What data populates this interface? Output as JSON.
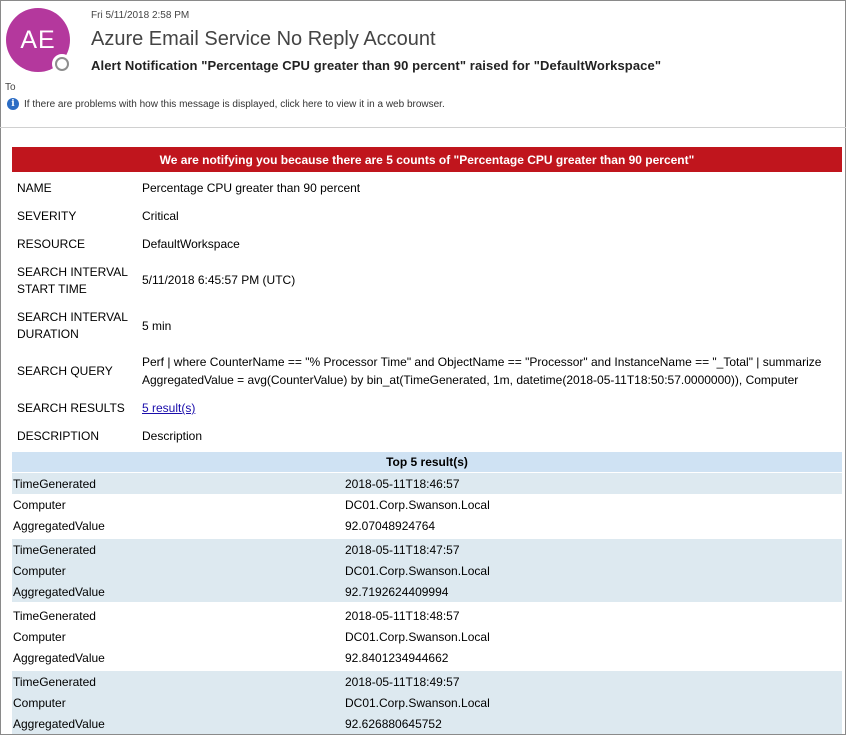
{
  "message": {
    "avatar_initials": "AE",
    "date": "Fri 5/11/2018 2:58 PM",
    "sender": "Azure Email Service No Reply Account",
    "subject": "Alert Notification \"Percentage CPU greater than 90 percent\" raised for \"DefaultWorkspace\"",
    "to_label": "To",
    "info_text": "If there are problems with how this message is displayed, click here to view it in a web browser."
  },
  "banner": "We are notifying you because there are 5 counts of \"Percentage CPU greater than 90 percent\"",
  "fields": {
    "name_label": "NAME",
    "name_value": "Percentage CPU greater than 90 percent",
    "severity_label": "SEVERITY",
    "severity_value": "Critical",
    "resource_label": "RESOURCE",
    "resource_value": "DefaultWorkspace",
    "start_label_1": "SEARCH INTERVAL",
    "start_label_2": "START TIME",
    "start_value": "5/11/2018 6:45:57 PM (UTC)",
    "duration_label_1": "SEARCH INTERVAL",
    "duration_label_2": "DURATION",
    "duration_value": "5 min",
    "query_label": "SEARCH QUERY",
    "query_line_1": "Perf | where CounterName == \"% Processor Time\" and ObjectName == \"Processor\" and InstanceName == \"_Total\" | summarize",
    "query_line_2": "AggregatedValue = avg(CounterValue) by bin_at(TimeGenerated, 1m, datetime(2018-05-11T18:50:57.0000000)), Computer",
    "results_label": "SEARCH RESULTS",
    "results_link": "5 result(s)",
    "description_label": "DESCRIPTION",
    "description_value": "Description"
  },
  "results": {
    "title": "Top 5 result(s)",
    "rows": [
      {
        "key": "TimeGenerated",
        "value": "2018-05-11T18:46:57"
      },
      {
        "key": "Computer",
        "value": "DC01.Corp.Swanson.Local"
      },
      {
        "key": "AggregatedValue",
        "value": "92.07048924764"
      },
      {
        "key": "TimeGenerated",
        "value": "2018-05-11T18:47:57"
      },
      {
        "key": "Computer",
        "value": "DC01.Corp.Swanson.Local"
      },
      {
        "key": "AggregatedValue",
        "value": "92.7192624409994"
      },
      {
        "key": "TimeGenerated",
        "value": "2018-05-11T18:48:57"
      },
      {
        "key": "Computer",
        "value": "DC01.Corp.Swanson.Local"
      },
      {
        "key": "AggregatedValue",
        "value": "92.8401234944662"
      },
      {
        "key": "TimeGenerated",
        "value": "2018-05-11T18:49:57"
      },
      {
        "key": "Computer",
        "value": "DC01.Corp.Swanson.Local"
      },
      {
        "key": "AggregatedValue",
        "value": "92.626880645752"
      }
    ]
  },
  "colors": {
    "avatar": "#b4389d",
    "banner": "#c0151d",
    "results_header": "#cfe2f3",
    "row_shade": "#dde9f0",
    "link": "#1a0dab"
  }
}
